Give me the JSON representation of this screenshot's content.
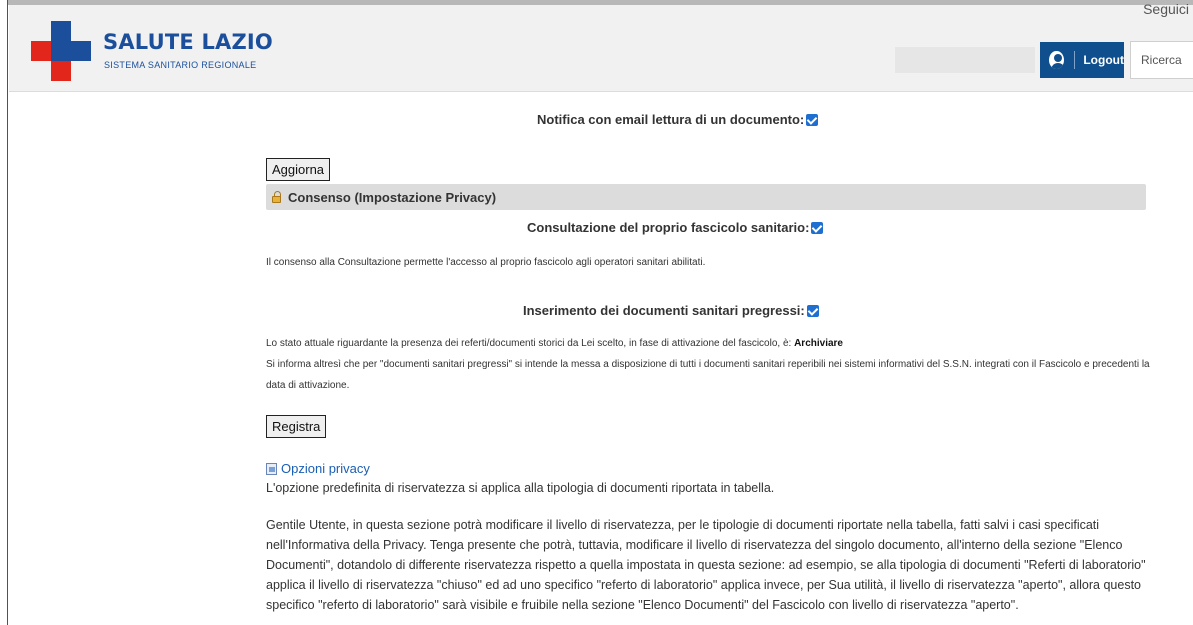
{
  "header": {
    "brand_title": "SALUTE LAZIO",
    "brand_subtitle": "SISTEMA SANITARIO REGIONALE",
    "seguici": "Seguici",
    "logout_label": "Logout",
    "search_placeholder": "Ricerca"
  },
  "colors": {
    "brand_blue": "#1b4f9c",
    "brand_red": "#e3261c",
    "logout_bg": "#0f4f8e",
    "checkbox": "#1f6fd1"
  },
  "icons": [
    "user-icon",
    "lock-icon",
    "document-icon",
    "checkbox-checked-icon"
  ],
  "notifications": {
    "email_read_label": "Notifica con email lettura di un documento:",
    "email_read_checked": true
  },
  "buttons": {
    "aggiorna": "Aggiorna",
    "registra": "Registra"
  },
  "consenso": {
    "section_title": "Consenso (Impostazione Privacy)",
    "consultazione_label": "Consultazione del proprio fascicolo sanitario:",
    "consultazione_checked": true,
    "consultazione_note": "Il consenso alla Consultazione permette l'accesso al proprio fascicolo agli operatori sanitari abilitati.",
    "pregressi_label": "Inserimento dei documenti sanitari pregressi:",
    "pregressi_checked": true,
    "stato_text": "Lo stato attuale riguardante la presenza dei referti/documenti storici da Lei scelto, in fase di attivazione del fascicolo, è: ",
    "stato_value": "Archiviare",
    "informa_line1": "Si informa altresì che per \"documenti sanitari pregressi\" si intende la messa a disposizione di tutti i documenti sanitari reperibili nei sistemi informativi del S.S.N. integrati con il Fascicolo e precedenti la",
    "informa_line2": "data di attivazione."
  },
  "privacy": {
    "link_label": "Opzioni privacy",
    "default_text": "L'opzione predefinita di riservatezza si applica alla tipologia di documenti riportata in tabella.",
    "gentile_line1": "Gentile Utente, in questa sezione potrà modificare il livello di riservatezza, per le tipologie di documenti riportate nella tabella, fatti salvi i casi specificati",
    "gentile_line2": "nell'Informativa della Privacy. Tenga presente che potrà, tuttavia, modificare il livello di riservatezza del singolo documento, all'interno della sezione \"Elenco",
    "gentile_line3": "Documenti\", dotandolo di differente riservatezza rispetto a quella impostata in questa sezione: ad esempio, se alla tipologia di documenti \"Referti di laboratorio\"",
    "gentile_line4": "applica il livello di riservatezza \"chiuso\" ed ad uno specifico \"referto di laboratorio\" applica invece, per Sua utilità, il livello di riservatezza \"aperto\", allora questo",
    "gentile_line5": "specifico \"referto di laboratorio\" sarà visibile e fruibile nella sezione \"Elenco Documenti\" del Fascicolo con livello di riservatezza \"aperto\"."
  }
}
